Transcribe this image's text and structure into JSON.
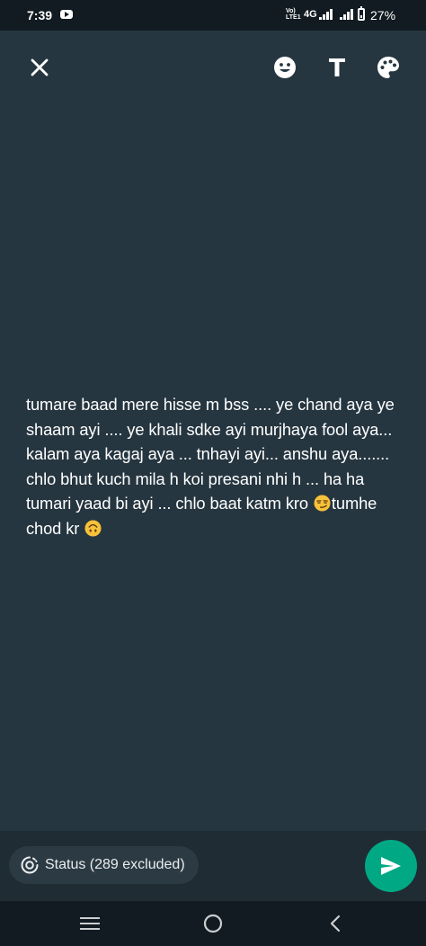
{
  "status_bar": {
    "time": "7:39",
    "volte": "Vo) LTE1",
    "network": "4G",
    "battery_percent": "27%",
    "battery_level": 0.27,
    "icons": [
      "youtube-icon",
      "signal-icon",
      "battery-icon"
    ]
  },
  "toolbar": {
    "icons": [
      "close-icon",
      "emoji-icon",
      "text-style-icon",
      "palette-icon"
    ]
  },
  "status_post": {
    "text_before_emoji1": "tumare baad mere hisse m bss .... ye chand aya ye shaam ayi .... ye khali sdke ayi murjhaya fool aya... kalam aya kagaj aya ... tnhayi ayi... anshu aya....... chlo bhut kuch mila h koi presani nhi h ... ha ha tumari yaad bi ayi ... chlo baat katm kro ",
    "emoji1": "smirking-face",
    "text_between": "tumhe chod kr ",
    "emoji2": "upside-down-face"
  },
  "composer": {
    "audience_label": "Status (289 excluded)",
    "send_label": "send"
  },
  "nav_bar": {
    "icons": [
      "recents-icon",
      "home-icon",
      "back-icon"
    ]
  },
  "colors": {
    "background": "#263640",
    "accent": "#00a884",
    "bar": "#1f2c34"
  }
}
